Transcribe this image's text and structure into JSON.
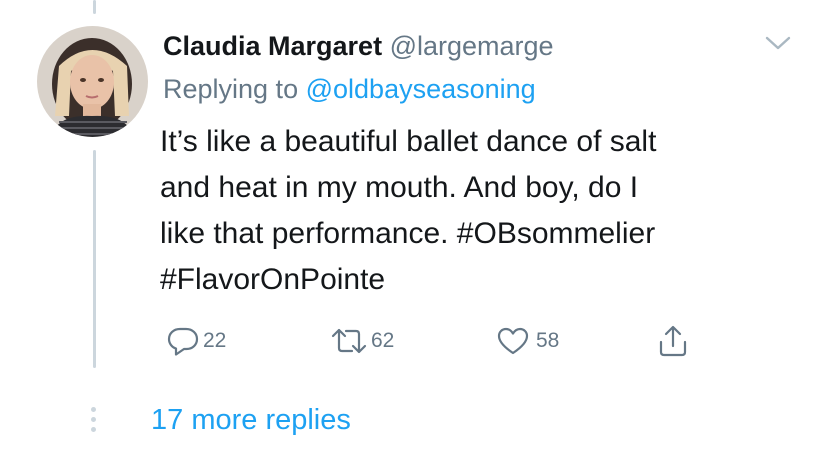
{
  "tweet": {
    "author_name": "Claudia Margaret",
    "author_handle": "@largemarge",
    "replying_prefix": "Replying to",
    "replying_handle": "@oldbayseasoning",
    "text_lines": [
      "It’s like a beautiful ballet dance of salt",
      "and heat in my mouth. And boy, do I",
      "like that performance. #OBsommelier",
      "#FlavorOnPointe"
    ],
    "actions": {
      "reply_count": "22",
      "retweet_count": "62",
      "like_count": "58"
    }
  },
  "thread": {
    "more_replies_label": "17 more replies"
  },
  "colors": {
    "link": "#1da1f2",
    "secondary": "#657786",
    "thread_line": "#ccd6dd"
  },
  "icons": {
    "reply": "reply-icon",
    "retweet": "retweet-icon",
    "like": "heart-icon",
    "share": "share-icon",
    "menu": "chevron-down-icon"
  }
}
